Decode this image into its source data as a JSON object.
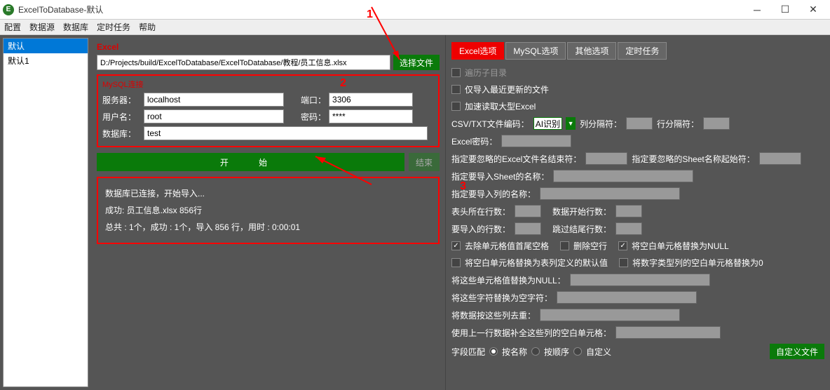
{
  "window": {
    "title": "ExcelToDatabase-默认"
  },
  "menu": [
    "配置",
    "数据源",
    "数据库",
    "定时任务",
    "帮助"
  ],
  "sidebar": {
    "items": [
      "默认",
      "默认1"
    ]
  },
  "excel": {
    "label": "Excel",
    "path": "D:/Projects/build/ExcelToDatabase/ExcelToDatabase/教程/员工信息.xlsx",
    "choose": "选择文件"
  },
  "mysql": {
    "title": "MySQL连接",
    "server_label": "服务器：",
    "server": "localhost",
    "port_label": "端口：",
    "port": "3306",
    "user_label": "用户名：",
    "user": "root",
    "pass_label": "密码：",
    "pass": "****",
    "db_label": "数据库：",
    "db": "test"
  },
  "actions": {
    "start": "开   始",
    "end": "结束"
  },
  "log": {
    "l1": "数据库已连接，开始导入...",
    "l2": "成功: 员工信息.xlsx 856行",
    "l3": "总共 : 1个，成功 : 1个，导入 856 行，用时 : 0:00:01"
  },
  "annotations": {
    "a1": "1",
    "a2": "2",
    "a3": "3"
  },
  "tabs": [
    "Excel选项",
    "MySQL选项",
    "其他选项",
    "定时任务"
  ],
  "opts": {
    "recurse": "遍历子目录",
    "only_recent": "仅导入最近更新的文件",
    "fast_large": "加速读取大型Excel",
    "csv_enc": "CSV/TXT文件编码：",
    "ai": "AI识别",
    "col_sep": "列分隔符：",
    "row_sep": "行分隔符：",
    "excel_pwd": "Excel密码：",
    "ignore_excel_end": "指定要忽略的Excel文件名结束符：",
    "ignore_sheet_start": "指定要忽略的Sheet名称起始符：",
    "import_sheet": "指定要导入Sheet的名称：",
    "import_col": "指定要导入列的名称：",
    "header_row": "表头所在行数：",
    "data_start": "数据开始行数：",
    "import_rows": "要导入的行数：",
    "skip_tail": "跳过结尾行数：",
    "trim": "去除单元格值首尾空格",
    "del_blank": "删除空行",
    "blank_null": "将空白单元格替换为NULL",
    "blank_default": "将空白单元格替换为表列定义的默认值",
    "num_zero": "将数字类型列的空白单元格替换为0",
    "cell_null": "将这些单元格值替换为NULL：",
    "char_blank": "将这些字符替换为空字符：",
    "dedup": "将数据按这些列去重：",
    "fill_prev": "使用上一行数据补全这些列的空白单元格：",
    "field_match": "字段匹配",
    "by_name": "按名称",
    "by_order": "按顺序",
    "custom": "自定义",
    "custom_btn": "自定义文件"
  }
}
